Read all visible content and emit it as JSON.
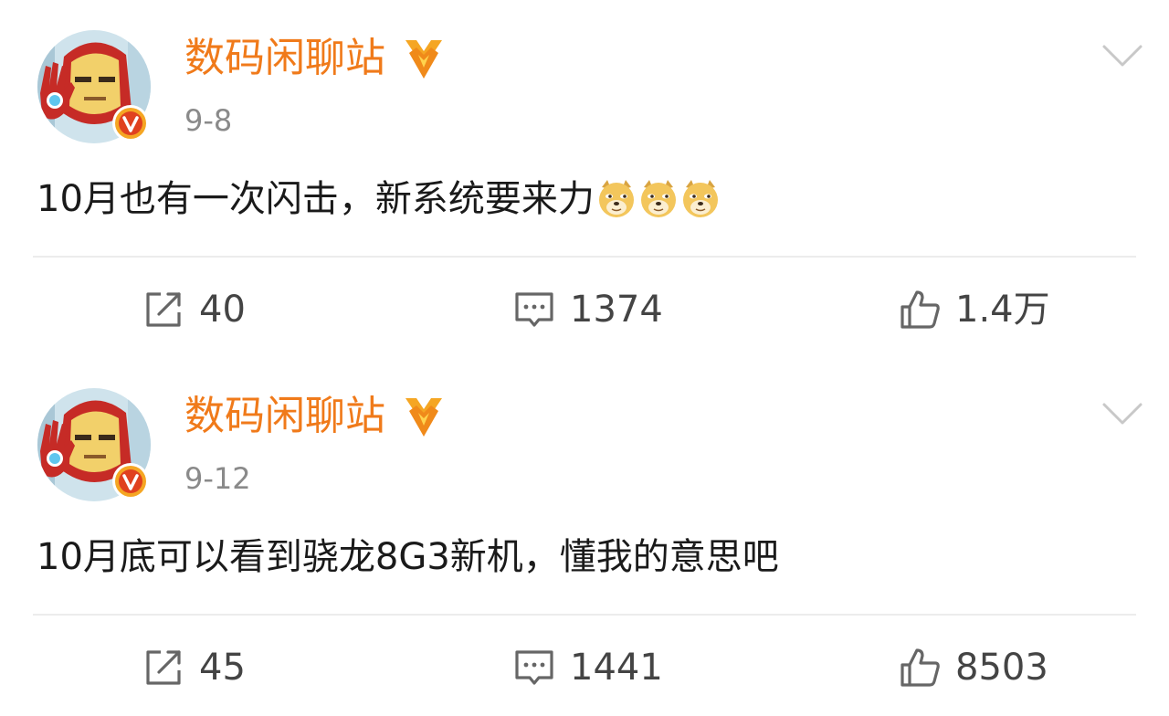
{
  "posts": [
    {
      "username": "数码闲聊站",
      "date": "9-8",
      "content": "10月也有一次闪击，新系统要来力",
      "emojis": [
        "doge-emoji",
        "doge-emoji",
        "doge-emoji"
      ],
      "reposts": "40",
      "comments": "1374",
      "likes": "1.4万"
    },
    {
      "username": "数码闲聊站",
      "date": "9-12",
      "content": "10月底可以看到骁龙8G3新机，懂我的意思吧",
      "emojis": [],
      "reposts": "45",
      "comments": "1441",
      "likes": "8503"
    }
  ],
  "colors": {
    "username": "#f07a1a",
    "date": "#8a8a8a",
    "verified_badge": "#f5a623",
    "accent": "#e0411f"
  },
  "icons": {
    "avatar": "iron-man-avatar",
    "verified": "verified-v-badge",
    "medal": "gold-medal-icon",
    "menu": "chevron-down-icon",
    "repost": "repost-icon",
    "comment": "comment-icon",
    "like": "thumbs-up-icon"
  }
}
